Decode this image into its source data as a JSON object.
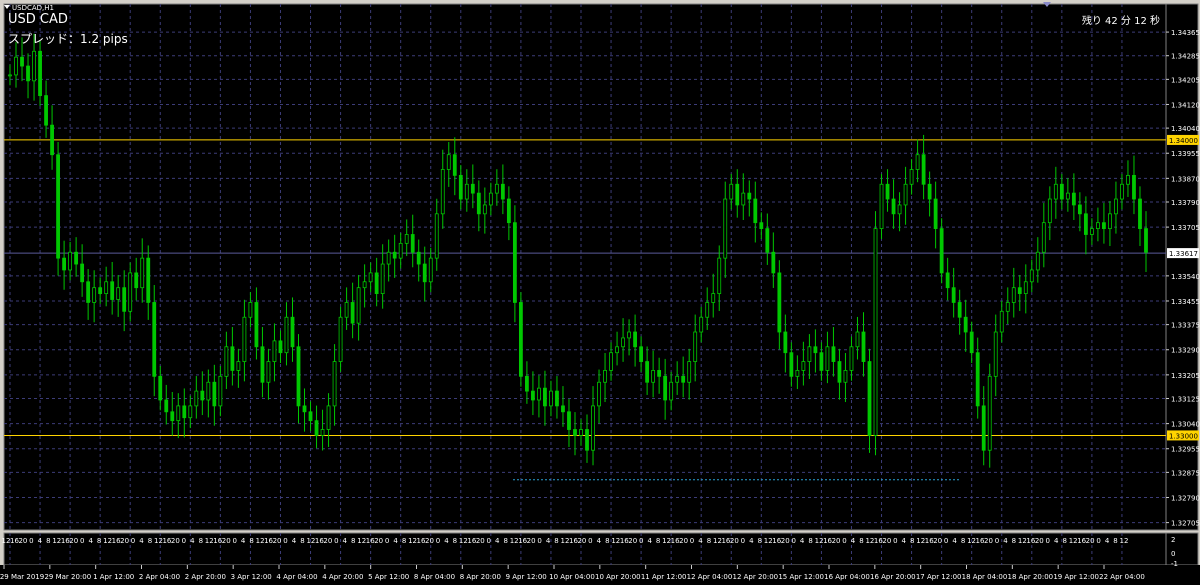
{
  "window": {
    "symbol_small": "USDCAD,H1",
    "symbol": "USD CAD",
    "spread": "スプレッド：1.2 pips",
    "timer": "残り 42 分 12 秒"
  },
  "colors": {
    "background": "#000000",
    "grid": "#3c3c78",
    "candle": "#00c800",
    "hline": "#ffd400",
    "text": "#ffffff",
    "price_axis_bg": "#000000"
  },
  "chart_data": {
    "type": "candlestick",
    "y_axis_ticks": [
      "1.34365",
      "1.34285",
      "1.34205",
      "1.34120",
      "1.34040",
      "1.33955",
      "1.33870",
      "1.33790",
      "1.33705",
      "1.33540",
      "1.33455",
      "1.33375",
      "1.33290",
      "1.33205",
      "1.33125",
      "1.33040",
      "1.32955",
      "1.32875",
      "1.32790",
      "1.32705"
    ],
    "ylim": [
      1.3268,
      1.3446
    ],
    "hour_ticks": [
      "12",
      "16",
      "20",
      "0",
      "4",
      "8",
      "12",
      "16",
      "20",
      "0",
      "4",
      "8",
      "12",
      "16",
      "20",
      "0",
      "4",
      "8",
      "12",
      "16",
      "20",
      "0",
      "4",
      "8",
      "12",
      "16",
      "20",
      "0",
      "4",
      "8",
      "12",
      "16",
      "20",
      "0",
      "4",
      "8",
      "12",
      "16",
      "20",
      "0",
      "4",
      "8",
      "12",
      "16",
      "20",
      "0",
      "4",
      "8",
      "12",
      "16",
      "20",
      "0",
      "4",
      "8",
      "12",
      "16",
      "20",
      "0",
      "4",
      "8",
      "12",
      "16",
      "20",
      "0",
      "4",
      "8",
      "12",
      "16",
      "20",
      "0",
      "4",
      "8",
      "12",
      "16",
      "20",
      "0",
      "4",
      "8",
      "12",
      "16",
      "20",
      "0",
      "4",
      "8",
      "12",
      "16",
      "20",
      "0",
      "4",
      "8",
      "12",
      "16",
      "20",
      "0",
      "4",
      "8",
      "12",
      "16",
      "20",
      "0",
      "4",
      "8",
      "12",
      "16",
      "20",
      "0",
      "4",
      "8",
      "12",
      "16",
      "20",
      "0",
      "4",
      "8",
      "12",
      "16",
      "20",
      "0",
      "4",
      "8",
      "12",
      "16",
      "20",
      "0",
      "4",
      "8",
      "12",
      "16",
      "20",
      "0",
      "4",
      "8",
      "12"
    ],
    "date_ticks": [
      "29 Mar 2019",
      "29 Mar 20:00",
      "1 Apr 12:00",
      "2 Apr 04:00",
      "2 Apr 20:00",
      "3 Apr 12:00",
      "4 Apr 04:00",
      "4 Apr 20:00",
      "5 Apr 12:00",
      "8 Apr 04:00",
      "8 Apr 20:00",
      "9 Apr 12:00",
      "10 Apr 04:00",
      "10 Apr 20:00",
      "11 Apr 12:00",
      "12 Apr 04:00",
      "12 Apr 20:00",
      "15 Apr 12:00",
      "16 Apr 04:00",
      "16 Apr 20:00",
      "17 Apr 12:00",
      "18 Apr 04:00",
      "18 Apr 20:00",
      "19 Apr 12:00",
      "22 Apr 04:00"
    ],
    "horizontal_lines": [
      {
        "label": "1.34000",
        "value": 1.34
      },
      {
        "label": "1.33000",
        "value": 1.33
      }
    ],
    "current_price": {
      "label": "1.33617",
      "value": 1.33617
    },
    "low_marker": {
      "value": 1.3285
    },
    "sub_axis_ticks": [
      "2",
      "0",
      "-1"
    ],
    "closes": [
      1.3422,
      1.3428,
      1.3425,
      1.342,
      1.343,
      1.3415,
      1.3405,
      1.3395,
      1.336,
      1.3356,
      1.3362,
      1.3358,
      1.3352,
      1.3345,
      1.335,
      1.3348,
      1.3352,
      1.3346,
      1.335,
      1.3342,
      1.3355,
      1.335,
      1.336,
      1.3345,
      1.332,
      1.3312,
      1.3308,
      1.3305,
      1.331,
      1.3306,
      1.331,
      1.3315,
      1.3312,
      1.3318,
      1.331,
      1.332,
      1.333,
      1.3322,
      1.3325,
      1.334,
      1.3345,
      1.333,
      1.3318,
      1.3325,
      1.3332,
      1.3328,
      1.334,
      1.333,
      1.331,
      1.3308,
      1.3305,
      1.33,
      1.3302,
      1.331,
      1.3325,
      1.334,
      1.3345,
      1.3338,
      1.335,
      1.3352,
      1.3355,
      1.3348,
      1.3358,
      1.3362,
      1.336,
      1.3365,
      1.3368,
      1.3362,
      1.3358,
      1.3352,
      1.336,
      1.3375,
      1.339,
      1.3395,
      1.3388,
      1.338,
      1.3385,
      1.3382,
      1.3375,
      1.3378,
      1.3382,
      1.3385,
      1.338,
      1.3372,
      1.3345,
      1.332,
      1.3315,
      1.3312,
      1.3316,
      1.331,
      1.3315,
      1.331,
      1.3308,
      1.3302,
      1.33,
      1.3302,
      1.3295,
      1.331,
      1.3318,
      1.3322,
      1.3328,
      1.333,
      1.3333,
      1.3335,
      1.333,
      1.3325,
      1.3318,
      1.3322,
      1.332,
      1.3312,
      1.3318,
      1.332,
      1.3318,
      1.3325,
      1.3335,
      1.334,
      1.3345,
      1.3348,
      1.336,
      1.338,
      1.3385,
      1.3378,
      1.3382,
      1.338,
      1.3372,
      1.337,
      1.3362,
      1.3355,
      1.3335,
      1.3328,
      1.332,
      1.3322,
      1.3325,
      1.333,
      1.3328,
      1.3322,
      1.333,
      1.3325,
      1.3318,
      1.3322,
      1.333,
      1.3335,
      1.3325,
      1.33,
      1.337,
      1.3385,
      1.338,
      1.3375,
      1.3378,
      1.3385,
      1.339,
      1.3395,
      1.3385,
      1.338,
      1.337,
      1.3355,
      1.335,
      1.3345,
      1.334,
      1.3335,
      1.3328,
      1.331,
      1.3295,
      1.332,
      1.3335,
      1.3342,
      1.3345,
      1.335,
      1.3348,
      1.3352,
      1.3356,
      1.3362,
      1.3372,
      1.338,
      1.3385,
      1.338,
      1.3382,
      1.3378,
      1.3375,
      1.3368,
      1.337,
      1.3372,
      1.337,
      1.3375,
      1.338,
      1.3385,
      1.3388,
      1.338,
      1.337,
      1.3362
    ]
  }
}
